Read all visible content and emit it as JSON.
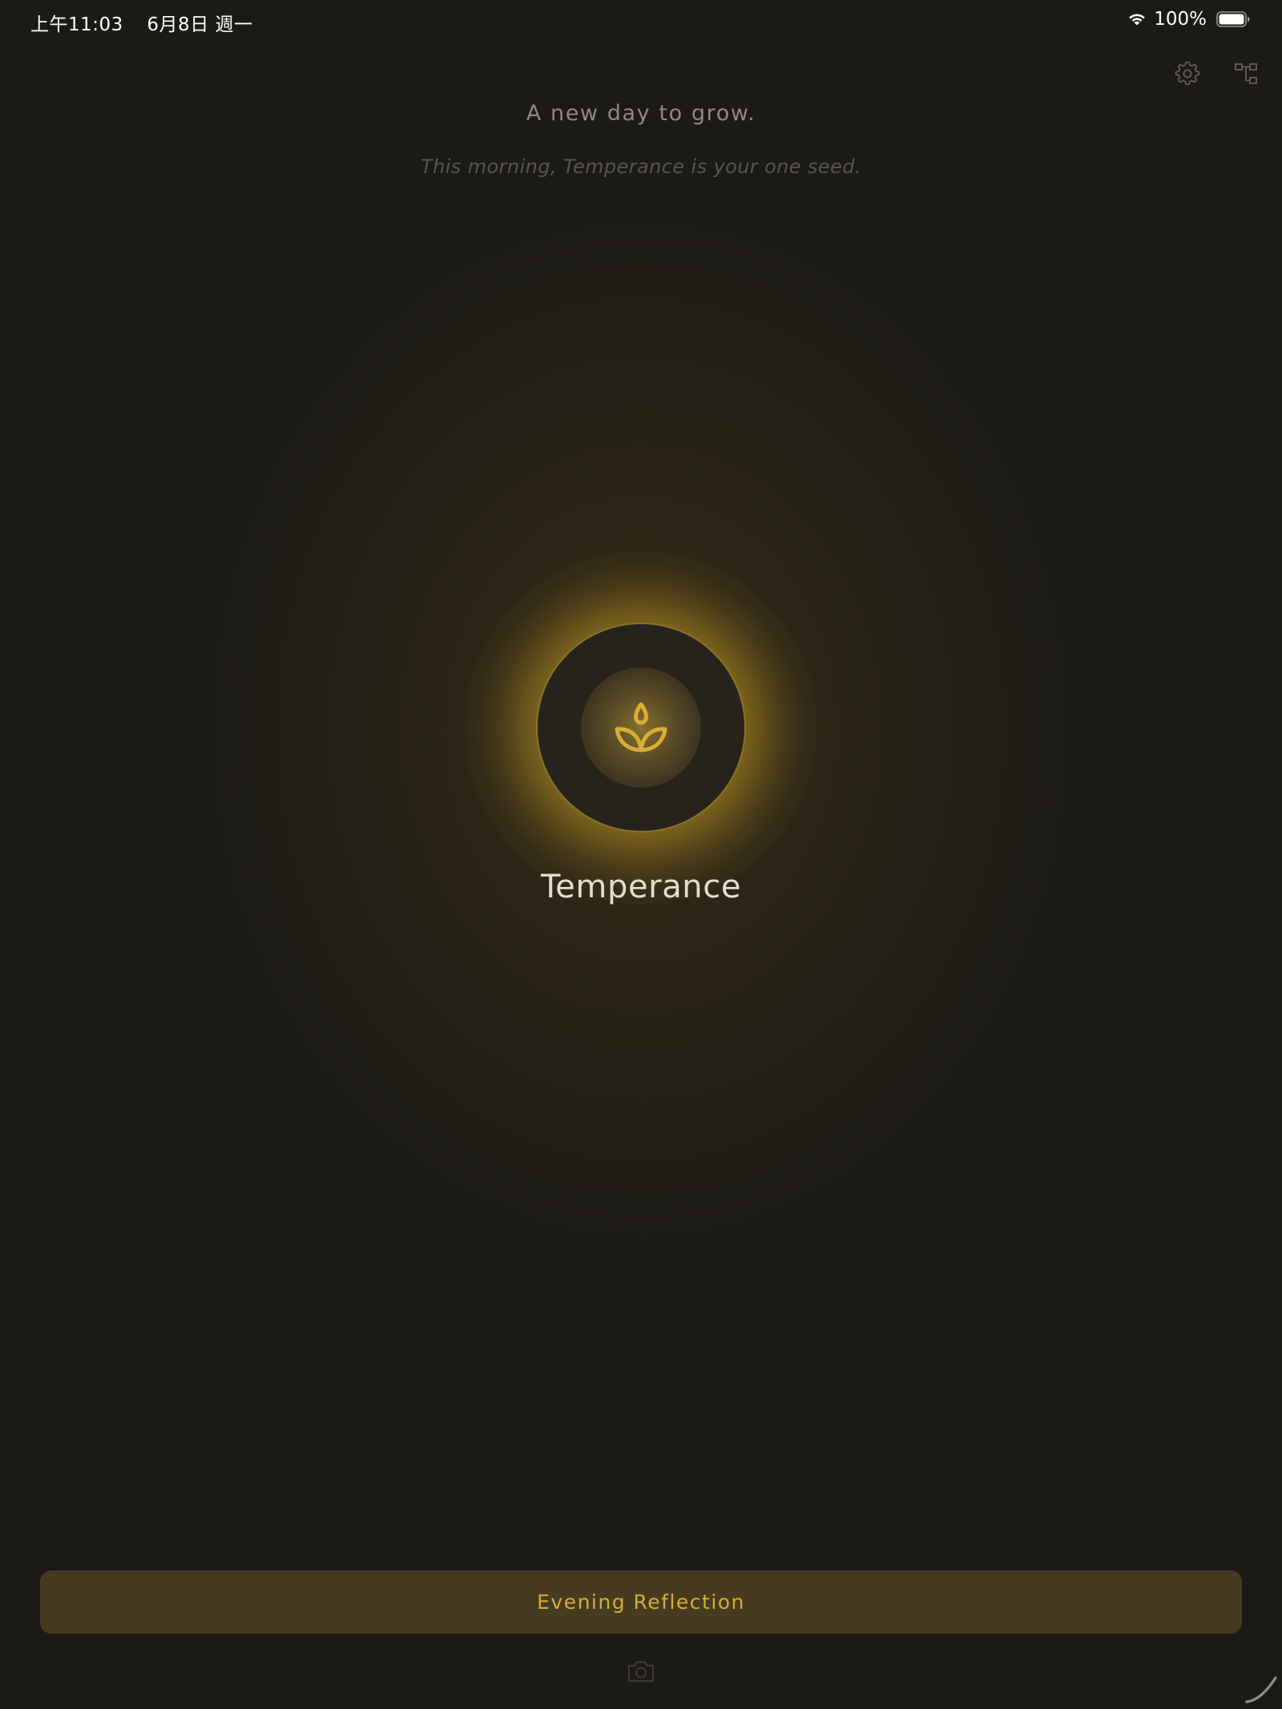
{
  "status_bar": {
    "time": "上午11:03",
    "date": "6月8日 週一",
    "battery_percent": "100%",
    "battery_level": 1.0,
    "icons": [
      "wifi-icon",
      "battery-icon"
    ]
  },
  "toolbar": {
    "icons": [
      "gear-icon",
      "tree-hierarchy-icon"
    ]
  },
  "header": {
    "greeting": "A new day to grow.",
    "subtitle": "This morning, Temperance is your one seed."
  },
  "seed": {
    "virtue": "Temperance",
    "icon": "sprout-icon"
  },
  "actions": {
    "primary_label": "Evening Reflection",
    "secondary_icon": "camera-icon"
  },
  "colors": {
    "background": "#1c1a16",
    "accent": "#d6ad36",
    "button_fill": "#463b20",
    "virtue_text": "#e4ddcf",
    "greeting_text": "#8f8a80"
  }
}
